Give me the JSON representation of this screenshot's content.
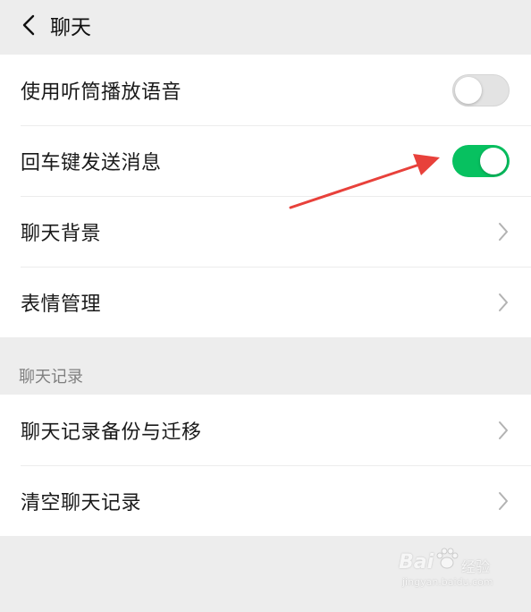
{
  "header": {
    "back_icon": "chevron-left-icon",
    "title": "聊天"
  },
  "settings_group": {
    "items": [
      {
        "label": "使用听筒播放语音",
        "control": "toggle",
        "toggle_on": false
      },
      {
        "label": "回车键发送消息",
        "control": "toggle",
        "toggle_on": true
      },
      {
        "label": "聊天背景",
        "control": "chevron-right-icon"
      },
      {
        "label": "表情管理",
        "control": "chevron-right-icon"
      }
    ]
  },
  "chat_history_section": {
    "header": "聊天记录",
    "items": [
      {
        "label": "聊天记录备份与迁移",
        "control": "chevron-right-icon"
      },
      {
        "label": "清空聊天记录",
        "control": "chevron-right-icon"
      }
    ]
  },
  "watermark": {
    "brand": "Bai",
    "sub": "经验",
    "url": "jingyan.baidu.com"
  },
  "colors": {
    "background": "#ededed",
    "card": "#ffffff",
    "toggle_on": "#07c160",
    "toggle_off": "#e3e3e3",
    "annotation_arrow": "#e8413b",
    "section_text": "#808080"
  }
}
